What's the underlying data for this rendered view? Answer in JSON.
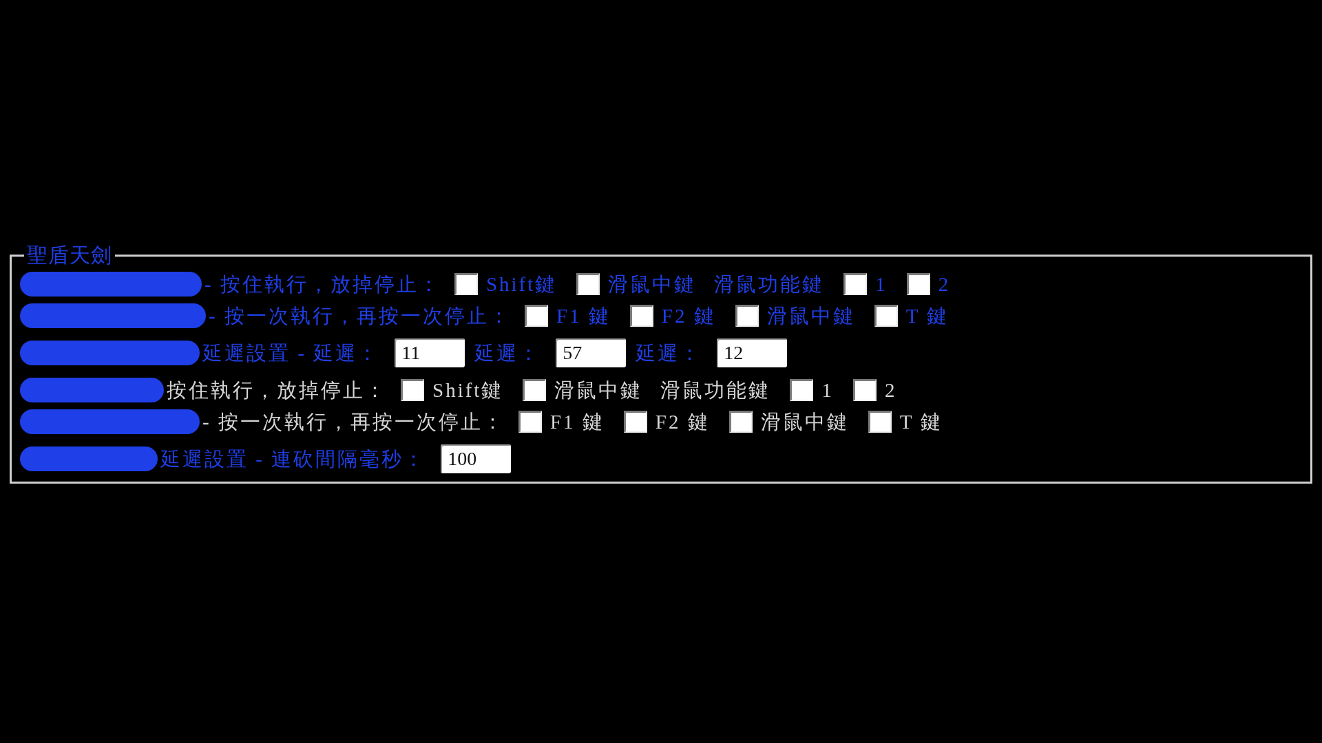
{
  "group": {
    "title": "聖盾天劍",
    "rows": [
      {
        "kind": "toggle",
        "color": "#1f3fe8",
        "label": "- 按住執行，放掉停止：",
        "items": [
          {
            "kind": "checkbox",
            "checked": false,
            "label": "Shift鍵"
          },
          {
            "kind": "checkbox",
            "checked": false,
            "label": "滑鼠中鍵"
          },
          {
            "kind": "text",
            "label": "滑鼠功能鍵"
          },
          {
            "kind": "checkbox",
            "checked": false,
            "label": "1"
          },
          {
            "kind": "checkbox",
            "checked": false,
            "label": "2"
          }
        ]
      },
      {
        "kind": "toggle",
        "color": "#1f3fe8",
        "label": "- 按一次執行，再按一次停止：",
        "items": [
          {
            "kind": "checkbox",
            "checked": false,
            "label": "F1 鍵"
          },
          {
            "kind": "checkbox",
            "checked": false,
            "label": "F2 鍵"
          },
          {
            "kind": "checkbox",
            "checked": false,
            "label": "滑鼠中鍵"
          },
          {
            "kind": "checkbox",
            "checked": false,
            "label": "T 鍵"
          }
        ]
      },
      {
        "kind": "delay",
        "color": "#1f3fe8",
        "label": "延遲設置 - 延遲：",
        "items": [
          {
            "kind": "input",
            "value": "11"
          },
          {
            "kind": "text",
            "label": "延遲："
          },
          {
            "kind": "input",
            "value": "57"
          },
          {
            "kind": "text",
            "label": "延遲："
          },
          {
            "kind": "input",
            "value": "12"
          }
        ]
      },
      {
        "kind": "toggle",
        "color": "#d6d6d6",
        "label": "按住執行，放掉停止：",
        "items": [
          {
            "kind": "checkbox",
            "checked": false,
            "label": "Shift鍵"
          },
          {
            "kind": "checkbox",
            "checked": false,
            "label": "滑鼠中鍵"
          },
          {
            "kind": "text",
            "label": "滑鼠功能鍵"
          },
          {
            "kind": "checkbox",
            "checked": false,
            "label": "1"
          },
          {
            "kind": "checkbox",
            "checked": false,
            "label": "2"
          }
        ]
      },
      {
        "kind": "toggle",
        "color": "#d6d6d6",
        "label": "- 按一次執行，再按一次停止：",
        "items": [
          {
            "kind": "checkbox",
            "checked": false,
            "label": "F1 鍵"
          },
          {
            "kind": "checkbox",
            "checked": false,
            "label": "F2 鍵"
          },
          {
            "kind": "checkbox",
            "checked": false,
            "label": "滑鼠中鍵"
          },
          {
            "kind": "checkbox",
            "checked": false,
            "label": "T 鍵"
          }
        ]
      },
      {
        "kind": "delay",
        "color": "#1f3fe8",
        "label": "延遲設置 - 連砍間隔毫秒：",
        "items": [
          {
            "kind": "input",
            "value": "100"
          }
        ]
      }
    ]
  }
}
